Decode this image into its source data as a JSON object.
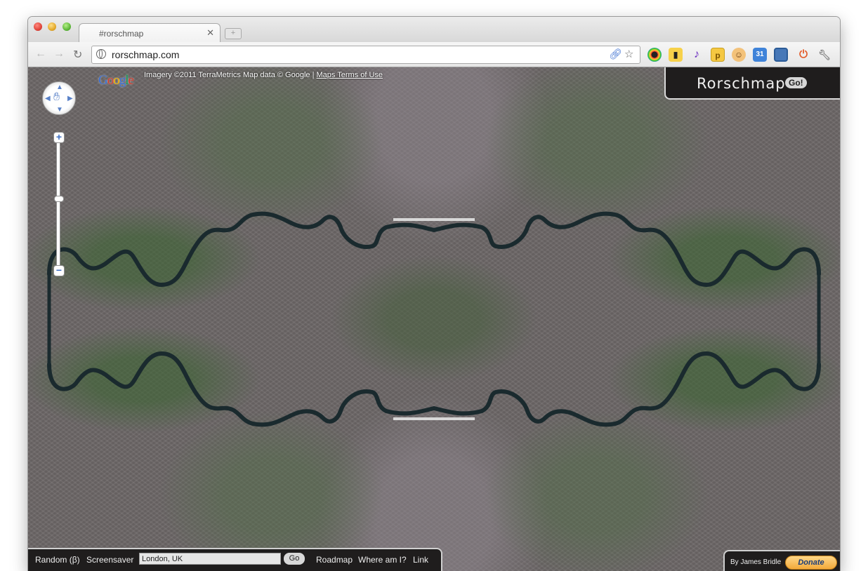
{
  "browser": {
    "tab_title": "#rorschmap",
    "tab_close": "✕",
    "new_tab": "+",
    "url": "rorschmap.com",
    "back": "←",
    "forward": "→",
    "reload": "↻"
  },
  "map": {
    "attribution_prefix": "Imagery ©2011 TerraMetrics Map data © Google | ",
    "terms_link": "Maps Terms of Use",
    "google_logo": "Google",
    "zoom_in": "+",
    "zoom_out": "−"
  },
  "brand": {
    "title": "Rorschmap",
    "go": "Go!"
  },
  "bottom": {
    "random": "Random (β)",
    "screensaver": "Screensaver",
    "location_value": "London, UK",
    "go": "Go",
    "roadmap": "Roadmap",
    "where": "Where am I?",
    "link": "Link"
  },
  "credits": {
    "author": "By James Bridle",
    "donate": "Donate"
  },
  "icons": [
    "link-icon",
    "star-icon",
    "color-wheel-icon",
    "phone-icon",
    "music-icon",
    "p-icon",
    "face-icon",
    "calendar-icon",
    "window-icon",
    "power-icon",
    "wrench-icon"
  ]
}
